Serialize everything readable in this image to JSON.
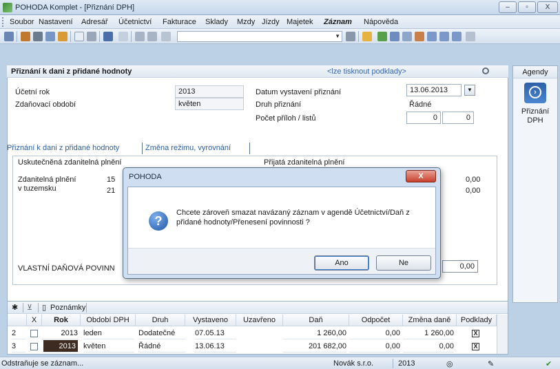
{
  "window": {
    "title": "POHODA Komplet - [Přiznání DPH]",
    "min": "–",
    "max": "▫",
    "close": "X"
  },
  "menu": [
    "Soubor",
    "Nastavení",
    "Adresář",
    "Účetnictví",
    "Fakturace",
    "Sklady",
    "Mzdy",
    "Jízdy",
    "Majetek",
    "Záznam",
    "Nápověda"
  ],
  "panel": {
    "title": "Přiznání k dani z přidané hodnoty",
    "note": "<lze tisknout podklady>",
    "ucetni_rok_label": "Účetní rok",
    "ucetni_rok_value": "2013",
    "zdanovaci_label": "Zdaňovací období",
    "zdanovaci_value": "květen",
    "datum_label": "Datum vystavení přiznání",
    "datum_value": "13.06.2013",
    "druh_label": "Druh přiznání",
    "druh_value": "Řádné",
    "pocet_label": "Počet příloh / listů",
    "pocet_prilohy": "0",
    "pocet_listy": "0"
  },
  "tabs": [
    "Přiznání k dani z přidané hodnoty",
    "Změna režimu, vyrovnání"
  ],
  "sub": {
    "uskutecnena": "Uskutečněná zdanitelná plnění",
    "prijata": "Přijatá zdanitelná plnění",
    "zdanitelna_label1": "Zdanitelná plnění",
    "zdanitelna_label2": "v tuzemsku",
    "val1": "15",
    "val2": "21",
    "right_val1": "0,00",
    "right_val2": "0,00",
    "vlastni_label": "VLASTNÍ DAŇOVÁ POVINN",
    "vlastni_value": "0,00"
  },
  "agendy": {
    "title": "Agendy",
    "label": "Přiznání DPH"
  },
  "grid": {
    "toolbar_note": "Poznámky",
    "columns": [
      "X",
      "Rok",
      "Období DPH",
      "Druh",
      "Vystaveno",
      "Uzavřeno",
      "Daň",
      "Odpočet",
      "Změna daně",
      "Podklady"
    ],
    "rows": [
      {
        "num": "2",
        "rok": "2013",
        "obdobi": "leden",
        "druh": "Dodatečné",
        "vystaveno": "07.05.13",
        "uzavreno": "",
        "dan": "1 260,00",
        "odpocet": "0,00",
        "zmena": "1 260,00",
        "podklady": "X"
      },
      {
        "num": "3",
        "rok": "2013",
        "obdobi": "květen",
        "druh": "Řádné",
        "vystaveno": "13.06.13",
        "uzavreno": "",
        "dan": "201 682,00",
        "odpocet": "0,00",
        "zmena": "0,00",
        "podklady": "X"
      }
    ]
  },
  "status": {
    "message": "Odstraňuje se záznam...",
    "company": "Novák s.r.o.",
    "year": "2013"
  },
  "dialog": {
    "title": "POHODA",
    "close": "X",
    "icon": "?",
    "text": "Chcete zároveň smazat navázaný záznam v agendě Účetnictví/Daň z přidané hodnoty/Přenesení povinnosti ?",
    "yes": "Ano",
    "no": "Ne"
  }
}
